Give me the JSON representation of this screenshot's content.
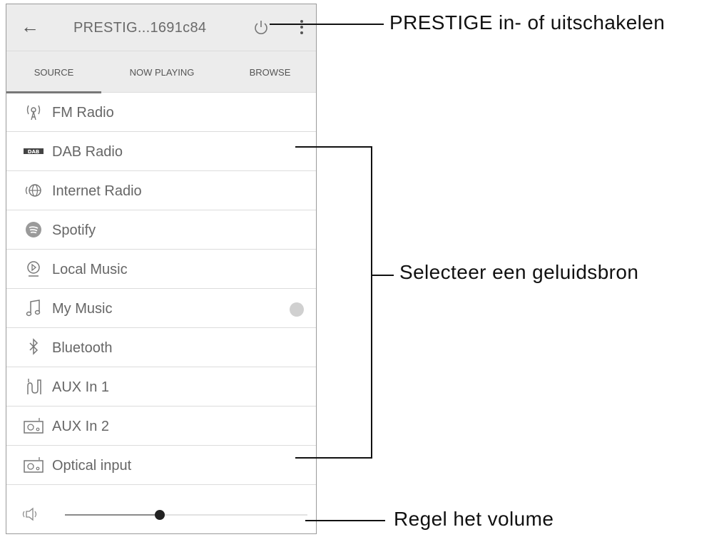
{
  "topbar": {
    "device_title": "PRESTIG...1691c84"
  },
  "tabs": [
    {
      "label": "SOURCE",
      "active": true
    },
    {
      "label": "NOW PLAYING",
      "active": false
    },
    {
      "label": "BROWSE",
      "active": false
    }
  ],
  "sources": [
    {
      "label": "FM Radio",
      "icon": "fm-radio-icon"
    },
    {
      "label": "DAB Radio",
      "icon": "dab-icon"
    },
    {
      "label": "Internet Radio",
      "icon": "internet-radio-icon"
    },
    {
      "label": "Spotify",
      "icon": "spotify-icon"
    },
    {
      "label": "Local Music",
      "icon": "local-music-icon"
    },
    {
      "label": "My Music",
      "icon": "music-note-icon"
    },
    {
      "label": "Bluetooth",
      "icon": "bluetooth-icon"
    },
    {
      "label": "AUX In 1",
      "icon": "aux-cable-icon"
    },
    {
      "label": "AUX In 2",
      "icon": "aux-device-icon"
    },
    {
      "label": "Optical input",
      "icon": "optical-device-icon"
    }
  ],
  "volume": {
    "level": 0.39
  },
  "callouts": {
    "power": "PRESTIGE in- of uitschakelen",
    "source": "Selecteer een geluidsbron",
    "volume": "Regel het volume"
  },
  "colors": {
    "header_bg": "#ececec",
    "text": "#666666",
    "knob": "#222222"
  }
}
